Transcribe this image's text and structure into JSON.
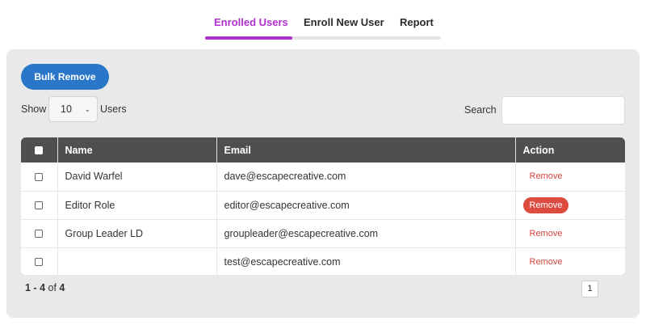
{
  "tabs": [
    {
      "label": "Enrolled Users",
      "active": true
    },
    {
      "label": "Enroll New User",
      "active": false
    },
    {
      "label": "Report",
      "active": false
    }
  ],
  "colors": {
    "accent": "#b12fd0",
    "primary": "#2a77c9",
    "danger": "#dd4a40",
    "header": "#4f4f4f",
    "panel": "#e9e9ea"
  },
  "toolbar": {
    "bulk_remove": "Bulk Remove"
  },
  "length": {
    "show_label": "Show",
    "selected": "10",
    "users_label": "Users"
  },
  "search": {
    "label": "Search",
    "value": ""
  },
  "table": {
    "columns": [
      "Name",
      "Email",
      "Action"
    ],
    "rows": [
      {
        "name": "David Warfel",
        "email": "dave@escapecreative.com",
        "action": "Remove",
        "highlight": false
      },
      {
        "name": "Editor Role",
        "email": "editor@escapecreative.com",
        "action": "Remove",
        "highlight": true
      },
      {
        "name": "Group Leader LD",
        "email": "groupleader@escapecreative.com",
        "action": "Remove",
        "highlight": false
      },
      {
        "name": "",
        "email": "test@escapecreative.com",
        "action": "Remove",
        "highlight": false
      }
    ]
  },
  "footer": {
    "range_start": "1",
    "range_sep": " - ",
    "range_end": "4",
    "of": " of ",
    "total": "4",
    "page": "1"
  }
}
